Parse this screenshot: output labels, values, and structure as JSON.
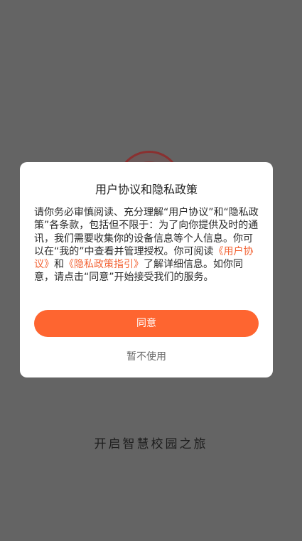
{
  "splash": {
    "slogan": "开启智慧校园之旅"
  },
  "dialog": {
    "title": "用户协议和隐私政策",
    "body_part1": "请你务必审慎阅读、充分理解“用户协议”和“隐私政策”各条款，包括但不限于：为了向你提供及时的通讯，我们需要收集你的设备信息等个人信息。你可以在“我的”中查看并管理授权。你可阅读",
    "link_user_agreement": "《用户协议》",
    "body_and": "和",
    "link_privacy_guide": "《隐私政策指引》",
    "body_part2": "了解详细信息。如你同意，请点击“同意”开始接受我们的服务。",
    "agree_label": "同意",
    "decline_label": "暂不使用"
  },
  "colors": {
    "overlay": "#646464",
    "accent": "#fe6530",
    "link": "#f26233"
  }
}
